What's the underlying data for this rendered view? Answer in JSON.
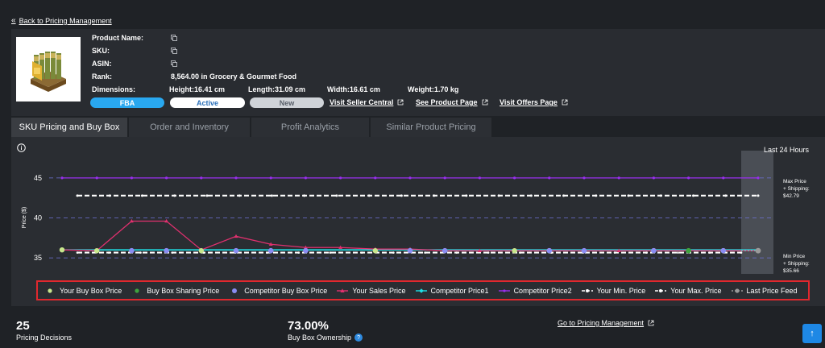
{
  "nav": {
    "back_label": "Back to Pricing Management",
    "back_icon": "double-chevron-left-icon"
  },
  "product": {
    "labels": {
      "name": "Product Name:",
      "sku": "SKU:",
      "asin": "ASIN:",
      "rank": "Rank:",
      "dimensions": "Dimensions:"
    },
    "rank_value": "8,564.00 in Grocery & Gourmet Food",
    "height": "Height:16.41 cm",
    "length": "Length:31.09 cm",
    "width": "Width:16.61 cm",
    "weight": "Weight:1.70 kg",
    "badges": {
      "fba": "FBA",
      "active": "Active",
      "new": "New"
    },
    "links": {
      "seller_central": "Visit Seller Central",
      "product_page": "See Product Page",
      "offers_page": "Visit Offers Page"
    }
  },
  "tabs": [
    {
      "label": "SKU Pricing and Buy Box",
      "active": true
    },
    {
      "label": "Order and Inventory",
      "active": false
    },
    {
      "label": "Profit Analytics",
      "active": false
    },
    {
      "label": "Similar Product Pricing",
      "active": false
    }
  ],
  "chart_header": {
    "range_label": "Last 24 Hours"
  },
  "chart_data": {
    "type": "line",
    "ylabel": "Price ($)",
    "ylim": [
      33.5,
      46.5
    ],
    "yticks": [
      "45",
      "40",
      "35"
    ],
    "points": 21,
    "series": [
      {
        "name": "Your Buy Box Price",
        "color": "#c8e68c",
        "values": [
          36.0,
          35.9,
          35.9,
          35.9,
          35.9,
          35.9,
          35.9,
          35.9,
          35.9,
          35.9,
          35.9,
          35.9,
          35.9,
          35.9,
          35.9,
          35.9,
          35.9,
          35.9,
          35.9,
          35.9,
          35.9
        ]
      },
      {
        "name": "Buy Box Sharing Price",
        "color": "#3ea33e",
        "values": [
          null,
          null,
          null,
          null,
          null,
          null,
          null,
          null,
          null,
          null,
          null,
          null,
          null,
          null,
          null,
          null,
          null,
          null,
          35.9,
          null,
          null
        ]
      },
      {
        "name": "Competitor Buy Box Price",
        "color": "#8a8cf2",
        "values": [
          null,
          null,
          35.9,
          35.9,
          null,
          35.9,
          35.9,
          35.9,
          null,
          null,
          35.9,
          35.9,
          null,
          null,
          35.9,
          35.9,
          null,
          35.9,
          null,
          35.9,
          null
        ]
      },
      {
        "name": "Your Sales Price",
        "color": "#e0306e",
        "values": [
          36.0,
          35.9,
          39.6,
          39.6,
          36.0,
          37.7,
          36.7,
          36.3,
          36.3,
          36.1,
          36.1,
          35.9,
          35.9,
          35.9,
          35.9,
          35.9,
          35.9,
          35.9,
          35.9,
          35.9,
          35.9
        ]
      },
      {
        "name": "Competitor Price1",
        "color": "#1ee0e6",
        "values": [
          36.0,
          36.0,
          36.0,
          36.0,
          36.0,
          36.0,
          36.0,
          36.0,
          36.0,
          36.0,
          36.0,
          36.0,
          36.0,
          36.0,
          36.0,
          36.0,
          36.0,
          36.0,
          36.0,
          36.0,
          36.0
        ]
      },
      {
        "name": "Competitor Price2",
        "color": "#9a2ef0",
        "values": [
          45.0,
          45.0,
          45.0,
          45.0,
          45.0,
          45.0,
          45.0,
          45.0,
          45.0,
          45.0,
          45.0,
          45.0,
          45.0,
          45.0,
          45.0,
          45.0,
          45.0,
          45.0,
          45.0,
          45.0,
          45.0
        ]
      },
      {
        "name": "Your Min. Price",
        "color": "#ffffff",
        "values": [
          35.66,
          35.66,
          35.66,
          35.66,
          35.66,
          35.66,
          35.66,
          35.66,
          35.66,
          35.66,
          35.66,
          35.66,
          35.66,
          35.66,
          35.66,
          35.66,
          35.66,
          35.66,
          35.66,
          35.66,
          35.66,
          35.66
        ]
      },
      {
        "name": "Your Max. Price",
        "color": "#ffffff",
        "values": [
          42.79,
          42.79,
          42.79,
          42.79,
          42.79,
          42.79,
          42.79,
          42.79,
          42.79,
          42.79,
          42.79,
          42.79,
          42.79,
          42.79,
          42.79,
          42.79,
          42.79,
          42.79,
          42.79,
          42.79,
          42.79,
          42.79
        ]
      },
      {
        "name": "Last Price Feed",
        "color": "#9a9a9a",
        "values": [
          35.9
        ]
      }
    ],
    "annotations": [
      {
        "lines": [
          "Max Price",
          "+ Shipping:",
          "$42.79"
        ]
      },
      {
        "lines": [
          "Min Price",
          "+ Shipping:",
          "$35.66"
        ]
      }
    ]
  },
  "stats": {
    "decisions_value": "25",
    "decisions_label": "Pricing Decisions",
    "ownership_value": "73.00%",
    "ownership_label": "Buy Box Ownership",
    "ownership_help_icon": "help-circle-icon",
    "go_label": "Go to Pricing Management",
    "scroll_top_icon": "arrow-up-icon"
  }
}
